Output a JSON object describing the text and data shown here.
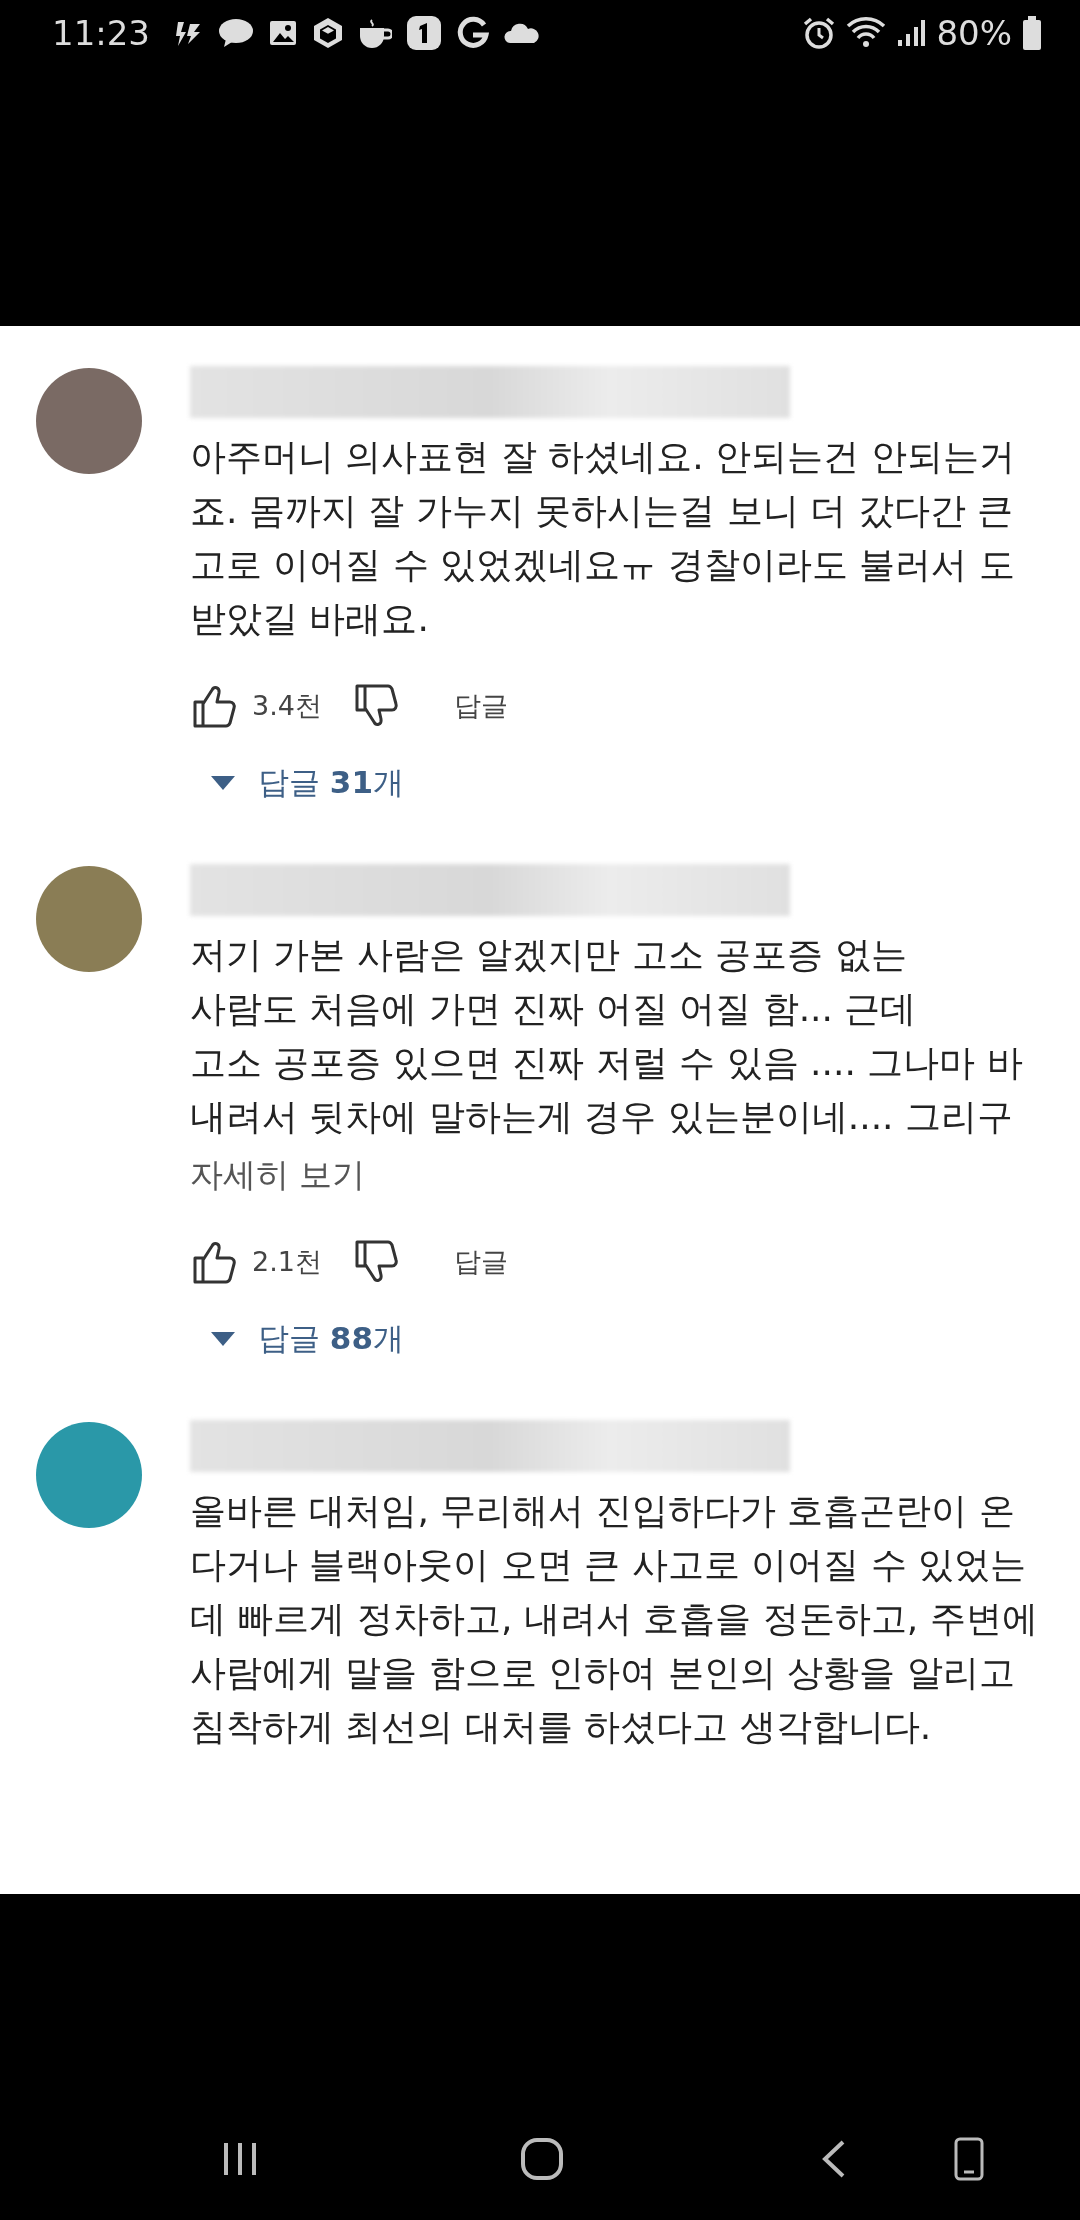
{
  "status_bar": {
    "time": "11:23",
    "battery": "80%"
  },
  "comments": [
    {
      "color": "#7a6a64",
      "lines": [
        "아주머니 의사표현 잘 하셨네요. 안되는건 안되는거",
        "죠. 몸까지 잘 가누지 못하시는걸 보니 더 갔다간 큰",
        "고로 이어질 수 있었겠네요ㅠ 경찰이라도 불러서 도",
        "받았길 바래요."
      ],
      "likes": "3.4천",
      "reply_button": "답글",
      "replies": {
        "label": "답글",
        "count": "31",
        "unit": "개"
      }
    },
    {
      "color": "#8a7d55",
      "lines": [
        "저기 가본 사람은 알겠지만 고소 공포증 없는",
        "사람도 처음에 가면 진짜 어질 어질 함... 근데",
        "고소 공포증 있으면 진짜 저럴 수 있음 .... 그나마 바",
        "내려서 뒷차에 말하는게 경우 있는분이네.... 그리구"
      ],
      "more": "자세히 보기",
      "likes": "2.1천",
      "reply_button": "답글",
      "replies": {
        "label": "답글",
        "count": "88",
        "unit": "개"
      }
    },
    {
      "color": "#2a98a8",
      "lines": [
        "올바른 대처임,  무리해서 진입하다가 호흡곤란이 온",
        "다거나 블랙아웃이 오면 큰 사고로  이어질 수 있었는",
        "데 빠르게 정차하고, 내려서 호흡을 정돈하고, 주변에",
        "사람에게 말을 함으로 인하여 본인의 상황을 알리고",
        "침착하게 최선의 대처를 하셨다고 생각합니다."
      ]
    }
  ]
}
